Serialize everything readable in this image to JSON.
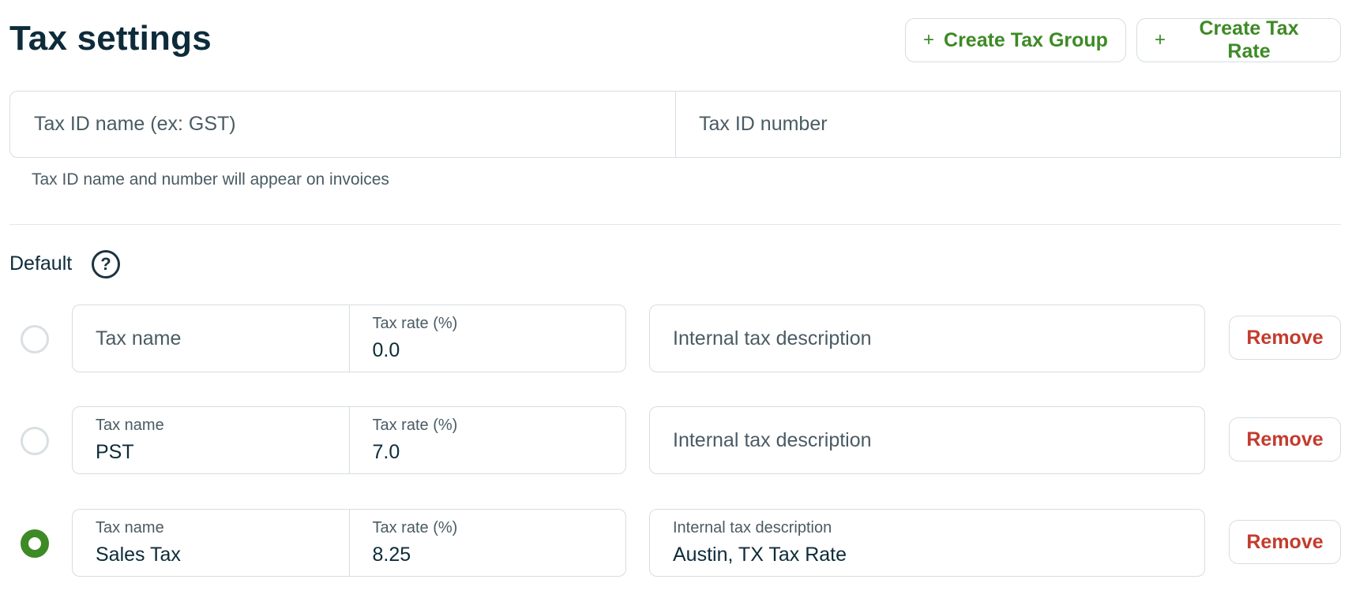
{
  "header": {
    "title": "Tax settings",
    "create_group_label": "Create Tax Group",
    "create_rate_label": "Create Tax Rate",
    "plus_glyph": "+"
  },
  "tax_id": {
    "name_placeholder": "Tax ID name (ex: GST)",
    "number_placeholder": "Tax ID number",
    "hint": "Tax ID name and number will appear on invoices"
  },
  "default_section": {
    "label": "Default",
    "help_glyph": "?"
  },
  "rows": [
    {
      "selected": false,
      "tax_name_placeholder": "Tax name",
      "tax_name_label": "",
      "tax_name_value": "",
      "tax_rate_label": "Tax rate (%)",
      "tax_rate_value": "0.0",
      "description_placeholder": "Internal tax description",
      "description_label": "",
      "description_value": "",
      "remove_label": "Remove"
    },
    {
      "selected": false,
      "tax_name_label": "Tax name",
      "tax_name_value": "PST",
      "tax_rate_label": "Tax rate (%)",
      "tax_rate_value": "7.0",
      "description_placeholder": "Internal tax description",
      "description_label": "",
      "description_value": "",
      "remove_label": "Remove"
    },
    {
      "selected": true,
      "tax_name_label": "Tax name",
      "tax_name_value": "Sales Tax",
      "tax_rate_label": "Tax rate (%)",
      "tax_rate_value": "8.25",
      "description_label": "Internal tax description",
      "description_value": "Austin, TX Tax Rate",
      "remove_label": "Remove"
    }
  ],
  "colors": {
    "accent_green": "#3d8a26",
    "remove_red": "#c43b2e",
    "title_text": "#0d2b3a",
    "border": "#d6dde1"
  }
}
